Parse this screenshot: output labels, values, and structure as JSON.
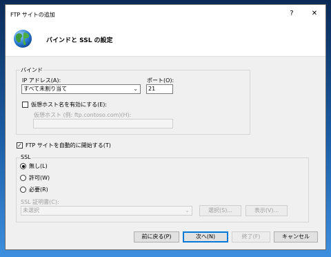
{
  "window": {
    "title": "FTP サイトの追加",
    "help_glyph": "?",
    "close_glyph": "✕"
  },
  "header": {
    "title": "バインドと SSL の設定"
  },
  "binding": {
    "group_label": "バインド",
    "ip_label": "IP アドレス(A):",
    "ip_value": "すべて未割り当て",
    "port_label": "ポート(O):",
    "port_value": "21",
    "virtual_host_checkbox_label": "仮想ホスト名を有効にする(E):",
    "virtual_host_checked": false,
    "virtual_host_label": "仮想ホスト (例: ftp.contoso.com)(H):",
    "virtual_host_value": ""
  },
  "auto_start": {
    "label": "FTP サイトを自動的に開始する(T)",
    "checked": true
  },
  "ssl": {
    "group_label": "SSL",
    "options": [
      {
        "label": "無し(L)",
        "selected": true
      },
      {
        "label": "許可(W)",
        "selected": false
      },
      {
        "label": "必要(R)",
        "selected": false
      }
    ],
    "cert_label": "SSL 証明書(C):",
    "cert_value": "未選択",
    "select_button": "選択(S)...",
    "view_button": "表示(V)..."
  },
  "footer": {
    "back_button": "前に戻る(P)",
    "next_button": "次へ(N)",
    "finish_button": "終了(F)",
    "cancel_button": "キャンセル"
  },
  "icons": {
    "globe": "globe-icon",
    "chevron": "chevron-down-icon",
    "check": "✓"
  }
}
